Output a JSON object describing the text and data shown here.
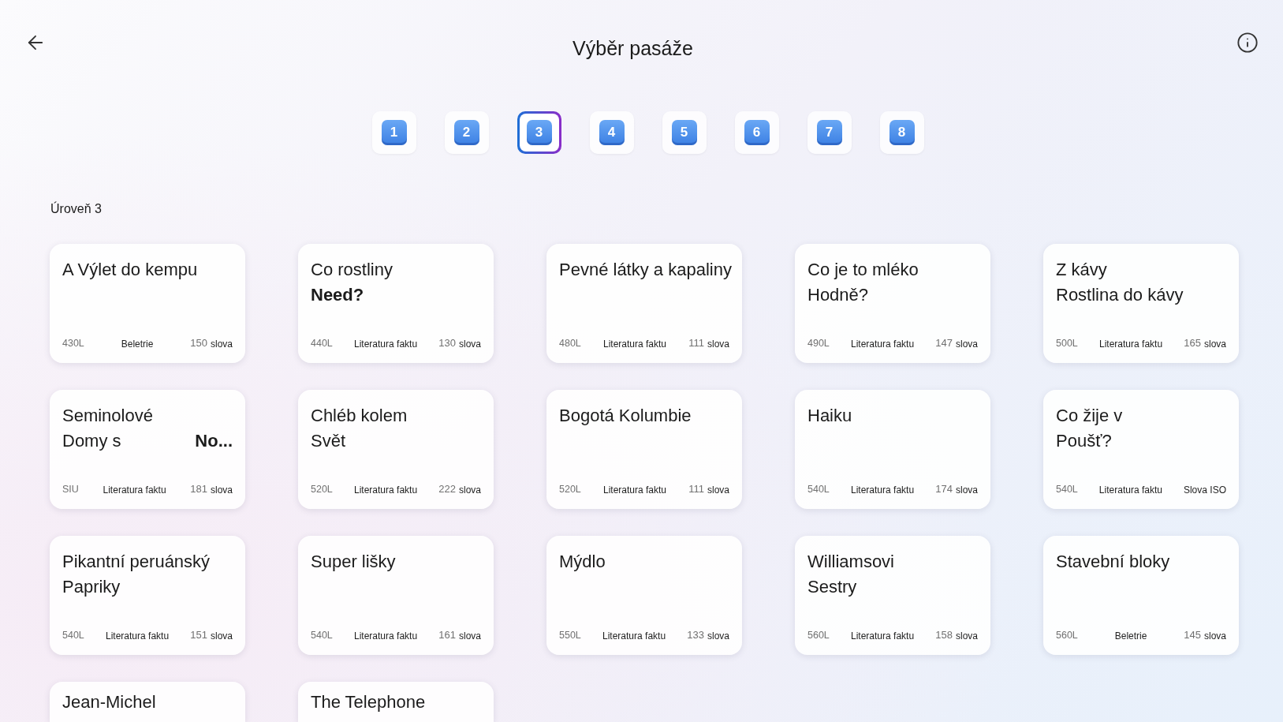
{
  "header": {
    "title": "Výběr pasáže"
  },
  "levels": [
    {
      "label": "1",
      "selected": false
    },
    {
      "label": "2",
      "selected": false
    },
    {
      "label": "3",
      "selected": true
    },
    {
      "label": "4",
      "selected": false
    },
    {
      "label": "5",
      "selected": false
    },
    {
      "label": "6",
      "selected": false
    },
    {
      "label": "7",
      "selected": false
    },
    {
      "label": "8",
      "selected": false
    }
  ],
  "section": {
    "title": "Úroveň 3"
  },
  "passages": [
    {
      "title_lines": [
        [
          "A Výlet do kempu"
        ]
      ],
      "meta": {
        "lexile": "430L",
        "genre": "Beletrie",
        "count": "150",
        "unit": "slova"
      }
    },
    {
      "title_lines": [
        [
          "Co rostliny"
        ],
        [
          "**Need?**"
        ]
      ],
      "meta": {
        "lexile": "440L",
        "genre": "Literatura faktu",
        "count": "130",
        "unit": "slova"
      }
    },
    {
      "title_lines": [
        [
          "Pevné látky a kapaliny"
        ]
      ],
      "meta": {
        "lexile": "480L",
        "genre": "Literatura faktu",
        "count": "111",
        "unit": "slova"
      }
    },
    {
      "title_lines": [
        [
          "Co je to mléko"
        ],
        [
          "Hodně?"
        ]
      ],
      "meta": {
        "lexile": "490L",
        "genre": "Literatura faktu",
        "count": "147",
        "unit": "slova"
      }
    },
    {
      "title_lines": [
        [
          "Z kávy"
        ],
        [
          "Rostlina do kávy"
        ]
      ],
      "meta": {
        "lexile": "500L",
        "genre": "Literatura faktu",
        "count": "165",
        "unit": "slova"
      }
    },
    {
      "title_lines": [
        [
          "Seminolové"
        ],
        [
          "Domy s",
          "**No...**"
        ]
      ],
      "meta": {
        "lexile": "SIU",
        "genre": "Literatura faktu",
        "count": "181",
        "unit": "slova"
      }
    },
    {
      "title_lines": [
        [
          "Chléb kolem"
        ],
        [
          "Svět"
        ]
      ],
      "meta": {
        "lexile": "520L",
        "genre": "Literatura faktu",
        "count": "222",
        "unit": "slova"
      }
    },
    {
      "title_lines": [
        [
          "Bogotá Kolumbie"
        ]
      ],
      "meta": {
        "lexile": "520L",
        "genre": "Literatura faktu",
        "count": "111",
        "unit": "slova"
      }
    },
    {
      "title_lines": [
        [
          "Haiku"
        ]
      ],
      "meta": {
        "lexile": "540L",
        "genre": "Literatura faktu",
        "count": "174",
        "unit": "slova"
      }
    },
    {
      "title_lines": [
        [
          "Co žije v"
        ],
        [
          "Poušť?"
        ]
      ],
      "meta": {
        "lexile": "540L",
        "genre": "Literatura faktu",
        "unit": "Slova ISO"
      }
    },
    {
      "title_lines": [
        [
          "Pikantní peruánský"
        ],
        [
          "Papriky"
        ]
      ],
      "meta": {
        "lexile": "540L",
        "genre": "Literatura faktu",
        "count": "151",
        "unit": "slova"
      }
    },
    {
      "title_lines": [
        [
          "Super lišky"
        ]
      ],
      "meta": {
        "lexile": "540L",
        "genre": "Literatura faktu",
        "count": "161",
        "unit": "slova"
      }
    },
    {
      "title_lines": [
        [
          "Mýdlo"
        ]
      ],
      "meta": {
        "lexile": "550L",
        "genre": "Literatura faktu",
        "count": "133",
        "unit": "slova"
      }
    },
    {
      "title_lines": [
        [
          "Williamsovi"
        ],
        [
          "Sestry"
        ]
      ],
      "meta": {
        "lexile": "560L",
        "genre": "Literatura faktu",
        "count": "158",
        "unit": "slova"
      }
    },
    {
      "title_lines": [
        [
          "Stavební bloky"
        ]
      ],
      "meta": {
        "lexile": "560L",
        "genre": "Beletrie",
        "count": "145",
        "unit": "slova"
      }
    },
    {
      "title_lines": [
        [
          "Jean-Michel"
        ]
      ]
    },
    {
      "title_lines": [
        [
          "The Telephone"
        ]
      ]
    }
  ]
}
